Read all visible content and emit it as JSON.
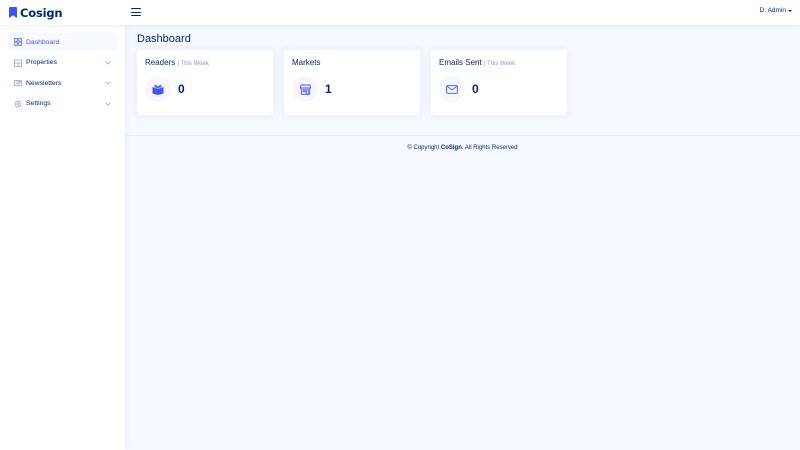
{
  "brand": {
    "name": "Cosign",
    "logo_icon": "bookmark-icon",
    "accent": "#4154f1",
    "text_color": "#012970"
  },
  "header": {
    "user_name": "D. Admin"
  },
  "sidebar": {
    "items": [
      {
        "label": "Dashboard",
        "icon": "grid-icon",
        "active": true
      },
      {
        "label": "Properties",
        "icon": "building-icon",
        "has_submenu": true
      },
      {
        "label": "Newsletters",
        "icon": "newspaper-icon",
        "has_submenu": true
      },
      {
        "label": "Settings",
        "icon": "gear-icon",
        "has_submenu": true
      }
    ]
  },
  "page": {
    "title": "Dashboard"
  },
  "cards": [
    {
      "title": "Readers",
      "subtitle": "| This Week",
      "value": "0",
      "icon": "book-icon"
    },
    {
      "title": "Markets",
      "subtitle": "",
      "value": "1",
      "icon": "shop-icon"
    },
    {
      "title": "Emails Sent",
      "subtitle": "| This Week",
      "value": "0",
      "icon": "envelope-icon"
    }
  ],
  "footer": {
    "prefix": "© Copyright ",
    "brand": "CoSign",
    "suffix": ". All Rights Reserved"
  }
}
